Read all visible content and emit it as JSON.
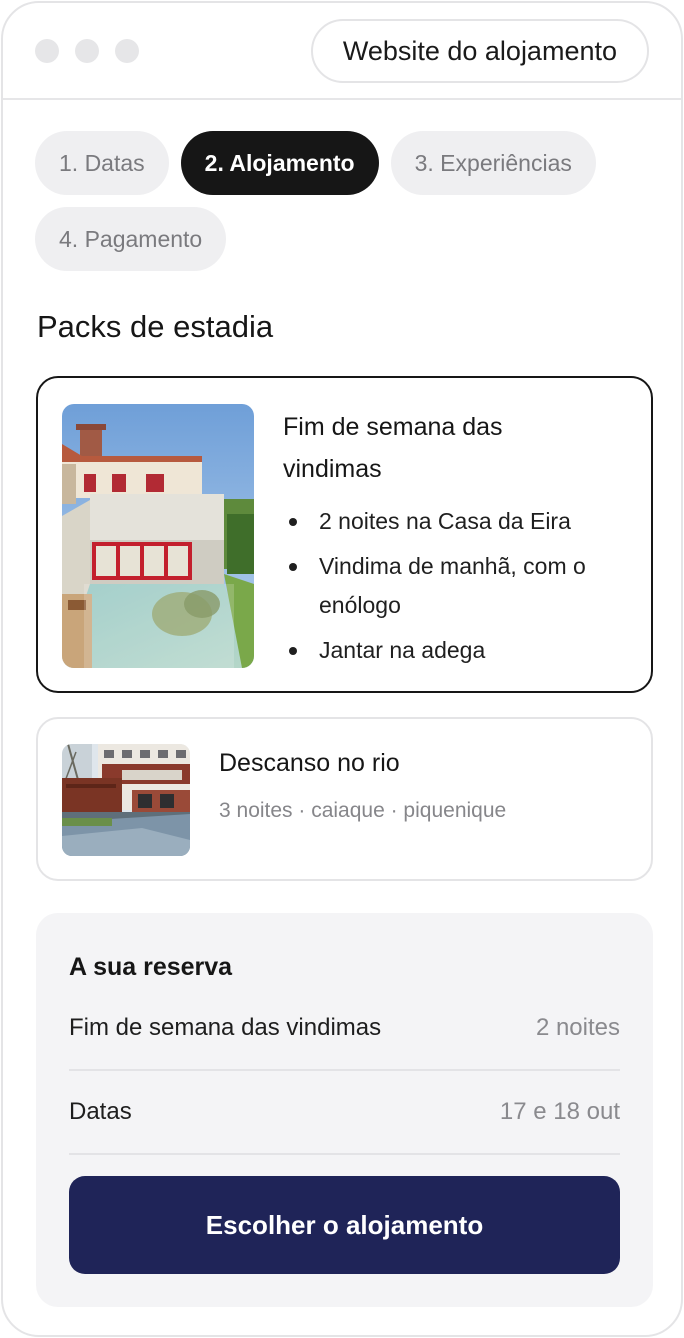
{
  "window": {
    "website_button_label": "Website do alojamento"
  },
  "steps": [
    {
      "label": "1. Datas",
      "active": false
    },
    {
      "label": "2. Alojamento",
      "active": true
    },
    {
      "label": "3. Experiências",
      "active": false
    },
    {
      "label": "4. Pagamento",
      "active": false
    }
  ],
  "section_title": "Packs de estadia",
  "packs": [
    {
      "title": "Fim de semana das vindimas",
      "selected": true,
      "features": [
        "2 noites na Casa da Eira",
        "Vindima de manhã, com o enólogo",
        "Jantar na adega"
      ]
    },
    {
      "title": "Descanso no rio",
      "selected": false,
      "subtitle": "3 noites · caiaque · piquenique"
    }
  ],
  "summary": {
    "title": "A sua reserva",
    "rows": [
      {
        "label": "Fim de semana das vindimas",
        "value": "2 noites"
      },
      {
        "label": "Datas",
        "value": "17 e 18 out"
      }
    ],
    "cta_label": "Escolher o alojamento"
  },
  "colors": {
    "accent_dark": "#161616",
    "cta": "#1f2458",
    "muted_bg": "#f4f4f6"
  }
}
